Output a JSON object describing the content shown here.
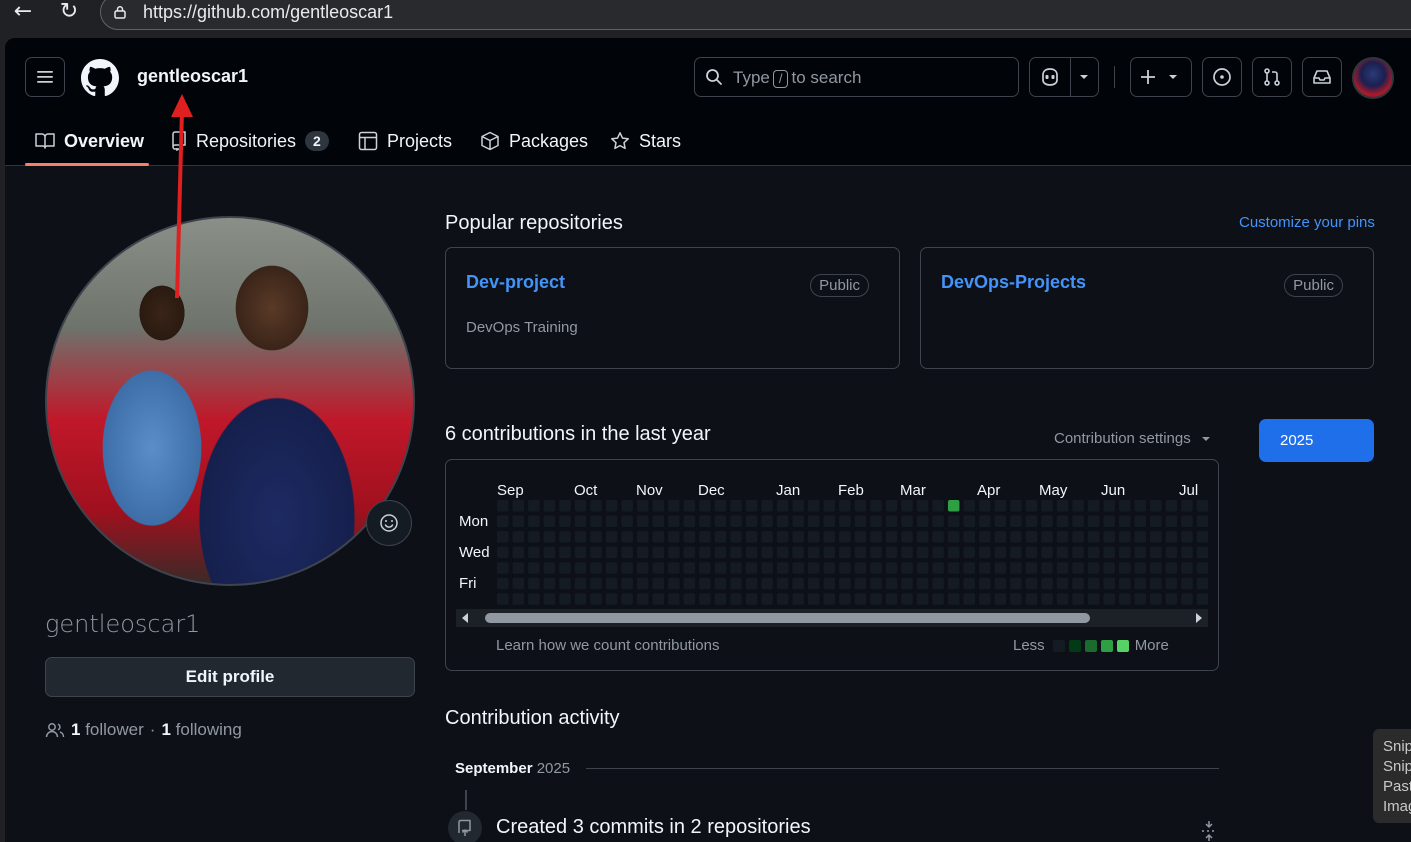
{
  "browser": {
    "url": "https://github.com/gentleoscar1"
  },
  "header": {
    "username": "gentleoscar1",
    "search_prefix": "Type",
    "search_key": "/",
    "search_suffix": "to search"
  },
  "tabs": [
    {
      "label": "Overview"
    },
    {
      "label": "Repositories",
      "count": "2"
    },
    {
      "label": "Projects"
    },
    {
      "label": "Packages"
    },
    {
      "label": "Stars"
    }
  ],
  "profile": {
    "name": "gentleoscar1",
    "edit_label": "Edit profile",
    "followers": "1",
    "followers_label": "follower",
    "separator": "·",
    "following": "1",
    "following_label": "following"
  },
  "popular": {
    "title": "Popular repositories",
    "customize": "Customize your pins",
    "repos": [
      {
        "name": "Dev-project",
        "visibility": "Public",
        "description": "DevOps Training"
      },
      {
        "name": "DevOps-Projects",
        "visibility": "Public",
        "description": ""
      }
    ]
  },
  "contributions": {
    "title": "6 contributions in the last year",
    "settings": "Contribution settings",
    "year": "2025",
    "months": [
      "Sep",
      "Oct",
      "Nov",
      "Dec",
      "Jan",
      "Feb",
      "Mar",
      "Apr",
      "May",
      "Jun",
      "Jul"
    ],
    "days": [
      "Mon",
      "Wed",
      "Fri"
    ],
    "learn_link": "Learn how we count contributions",
    "less": "Less",
    "more": "More",
    "active_cell": {
      "week": 29,
      "day": 0
    },
    "colors": {
      "empty": "#151b23",
      "l1": "#033a16",
      "l2": "#196c2e",
      "l3": "#2ea043",
      "l4": "#56d364"
    }
  },
  "activity": {
    "title": "Contribution activity",
    "month": "September",
    "year": "2025",
    "item": "Created 3 commits in 2 repositories"
  },
  "snip": [
    "Snip",
    "Snip",
    "Past",
    "Imag"
  ]
}
